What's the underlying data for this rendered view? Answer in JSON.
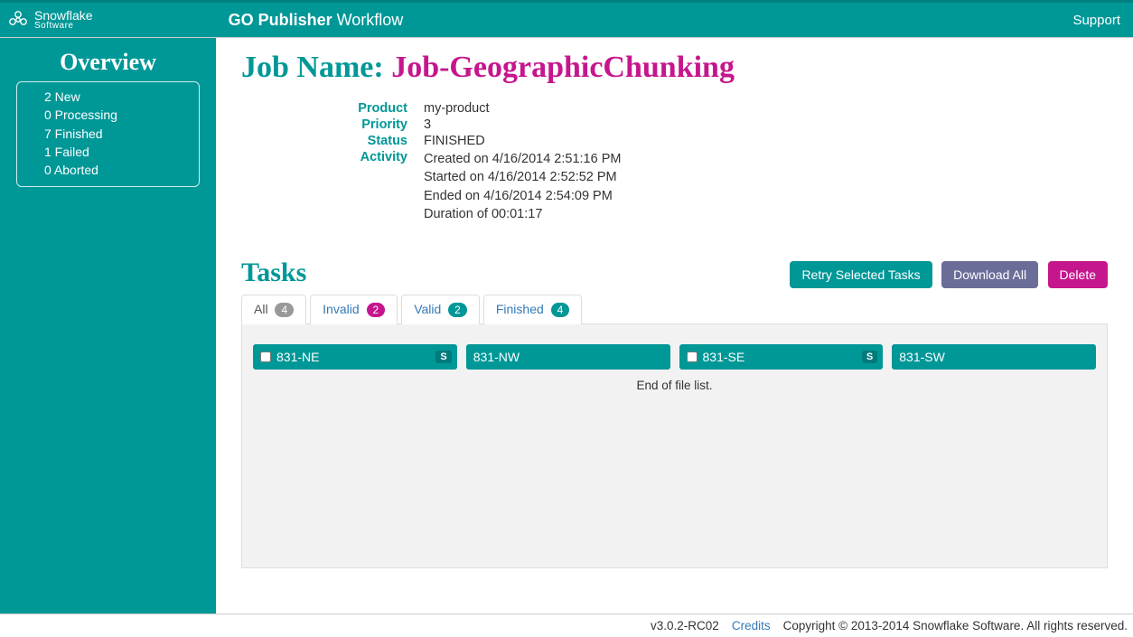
{
  "header": {
    "brand_line1": "Snowflake",
    "brand_line2": "Software",
    "product_bold": "GO Publisher",
    "product_rest": " Workflow",
    "support": "Support"
  },
  "sidebar": {
    "title": "Overview",
    "items": [
      "2 New",
      "0 Processing",
      "7 Finished",
      "1 Failed",
      "0 Aborted"
    ]
  },
  "job": {
    "label": "Job Name: ",
    "name": "Job-GeographicChunking",
    "fields": {
      "product_label": "Product",
      "product_value": "my-product",
      "priority_label": "Priority",
      "priority_value": "3",
      "status_label": "Status",
      "status_value": "FINISHED",
      "activity_label": "Activity",
      "activity_lines": [
        "Created on 4/16/2014 2:51:16 PM",
        "Started on 4/16/2014 2:52:52 PM",
        "Ended on 4/16/2014 2:54:09 PM",
        "Duration of 00:01:17"
      ]
    }
  },
  "tasks": {
    "heading": "Tasks",
    "buttons": {
      "retry": "Retry Selected Tasks",
      "download": "Download All",
      "delete": "Delete"
    },
    "tabs": {
      "all_label": "All",
      "all_count": "4",
      "invalid_label": "Invalid",
      "invalid_count": "2",
      "valid_label": "Valid",
      "valid_count": "2",
      "finished_label": "Finished",
      "finished_count": "4"
    },
    "chips": [
      {
        "label": "831-NE",
        "checkbox": true,
        "s": true
      },
      {
        "label": "831-NW",
        "checkbox": false,
        "s": false
      },
      {
        "label": "831-SE",
        "checkbox": true,
        "s": true
      },
      {
        "label": "831-SW",
        "checkbox": false,
        "s": false
      }
    ],
    "eof": "End of file list."
  },
  "footer": {
    "version": "v3.0.2-RC02",
    "credits": "Credits",
    "copyright": "Copyright © 2013-2014 Snowflake Software. All rights reserved."
  }
}
